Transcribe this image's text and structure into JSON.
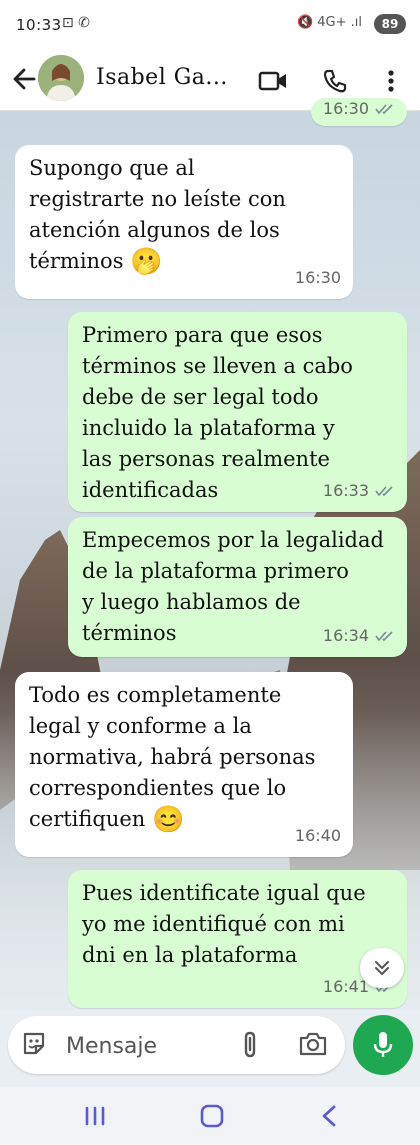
{
  "status_bar": {
    "time": "10:33",
    "left_icons": "⊡ ✆",
    "right_icons": "🔇 4G+ .ıl",
    "battery": "89"
  },
  "header": {
    "contact_name": "Isabel Ga...",
    "avatar_icon": "avatar-photo",
    "back_icon": "back-arrow-icon",
    "video_icon": "video-call-icon",
    "call_icon": "phone-icon",
    "menu_icon": "more-vert-icon"
  },
  "messages": [
    {
      "direction": "out",
      "text": "",
      "time": "16:30",
      "status": "read"
    },
    {
      "direction": "in",
      "text": "Supongo que al\nregistrarte no leíste con\natención algunos de los\ntérminos",
      "emoji": "🫢",
      "time": "16:30"
    },
    {
      "direction": "out",
      "text": "Primero para que esos\ntérminos se lleven a cabo\ndebe de ser legal todo\nincluido la plataforma y\nlas personas realmente\nidentificadas",
      "time": "16:33",
      "status": "read"
    },
    {
      "direction": "out",
      "text": "Empecemos por la legalidad\nde la plataforma primero\ny luego hablamos de\ntérminos",
      "time": "16:34",
      "status": "read"
    },
    {
      "direction": "in",
      "text": "Todo es completamente\nlegal y conforme a la\nnormativa, habrá personas\ncorrespondientes que lo\ncertifiquen",
      "emoji": "😊",
      "time": "16:40"
    },
    {
      "direction": "out",
      "text": "Pues identificate igual que\nyo me identifiqué con mi\ndni en la plataforma",
      "time": "16:41",
      "status": "read"
    }
  ],
  "input_bar": {
    "placeholder": "Mensaje",
    "sticker_icon": "sticker-icon",
    "attach_icon": "paperclip-icon",
    "camera_icon": "camera-icon",
    "mic_icon": "mic-icon"
  },
  "nav_bar": {
    "recents_icon": "recents-icon",
    "home_icon": "home-icon",
    "back_icon": "nav-back-icon"
  },
  "colors": {
    "outgoing_bubble": "#d9fdd3",
    "incoming_bubble": "#ffffff",
    "accent_green": "#1da851",
    "read_ticks": "#7a8a96"
  }
}
